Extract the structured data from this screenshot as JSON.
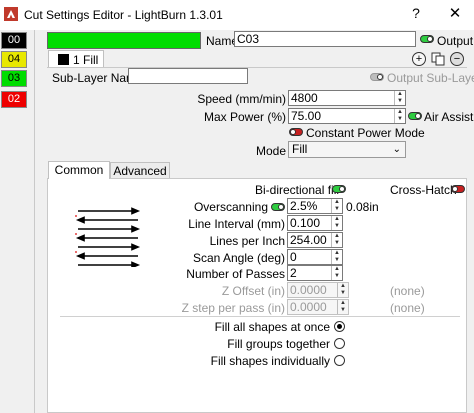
{
  "window": {
    "title": "Cut Settings Editor - LightBurn 1.3.01",
    "help_label": "?",
    "close_label": "✕"
  },
  "layers": [
    {
      "label": "00",
      "color": "#000000",
      "text_color": "#ffffff"
    },
    {
      "label": "04",
      "color": "#e8e800",
      "text_color": "#000000"
    },
    {
      "label": "03",
      "color": "#00dd00",
      "text_color": "#000000"
    },
    {
      "label": "02",
      "color": "#ee0000",
      "text_color": "#ffffff"
    }
  ],
  "header": {
    "layer_color": "#00dd00",
    "name_label": "Name",
    "name_value": "C03",
    "output_label": "Output",
    "output_on": true
  },
  "sublayer": {
    "tab_label": "1 Fill",
    "name_label": "Sub-Layer Name",
    "name_value": "",
    "output_label": "Output Sub-Layer"
  },
  "settings": {
    "speed_label": "Speed (mm/min)",
    "speed_value": "4800",
    "power_label": "Max Power (%)",
    "power_value": "75.00",
    "air_assist_label": "Air Assist",
    "constant_power_label": "Constant Power Mode",
    "mode_label": "Mode",
    "mode_value": "Fill"
  },
  "tabs": {
    "common": "Common",
    "advanced": "Advanced"
  },
  "fill": {
    "bidirectional_label": "Bi-directional fill",
    "crosshatch_label": "Cross-Hatch",
    "overscanning_label": "Overscanning",
    "overscanning_value": "2.5%",
    "overscanning_extra": "0.08in",
    "line_interval_label": "Line Interval (mm)",
    "line_interval_value": "0.100",
    "lpi_label": "Lines per Inch",
    "lpi_value": "254.00",
    "scan_angle_label": "Scan Angle (deg)",
    "scan_angle_value": "0",
    "passes_label": "Number of Passes",
    "passes_value": "2",
    "z_offset_label": "Z Offset (in)",
    "z_offset_value": "0.0000",
    "z_offset_note": "(none)",
    "z_step_label": "Z step per pass (in)",
    "z_step_value": "0.0000",
    "z_step_note": "(none)"
  },
  "fill_grouping": {
    "all_label": "Fill all shapes at once",
    "groups_label": "Fill groups together",
    "individual_label": "Fill shapes individually",
    "selected": "all"
  },
  "icons": {
    "add": "add-icon",
    "copy": "copy-icon",
    "remove": "remove-icon"
  }
}
